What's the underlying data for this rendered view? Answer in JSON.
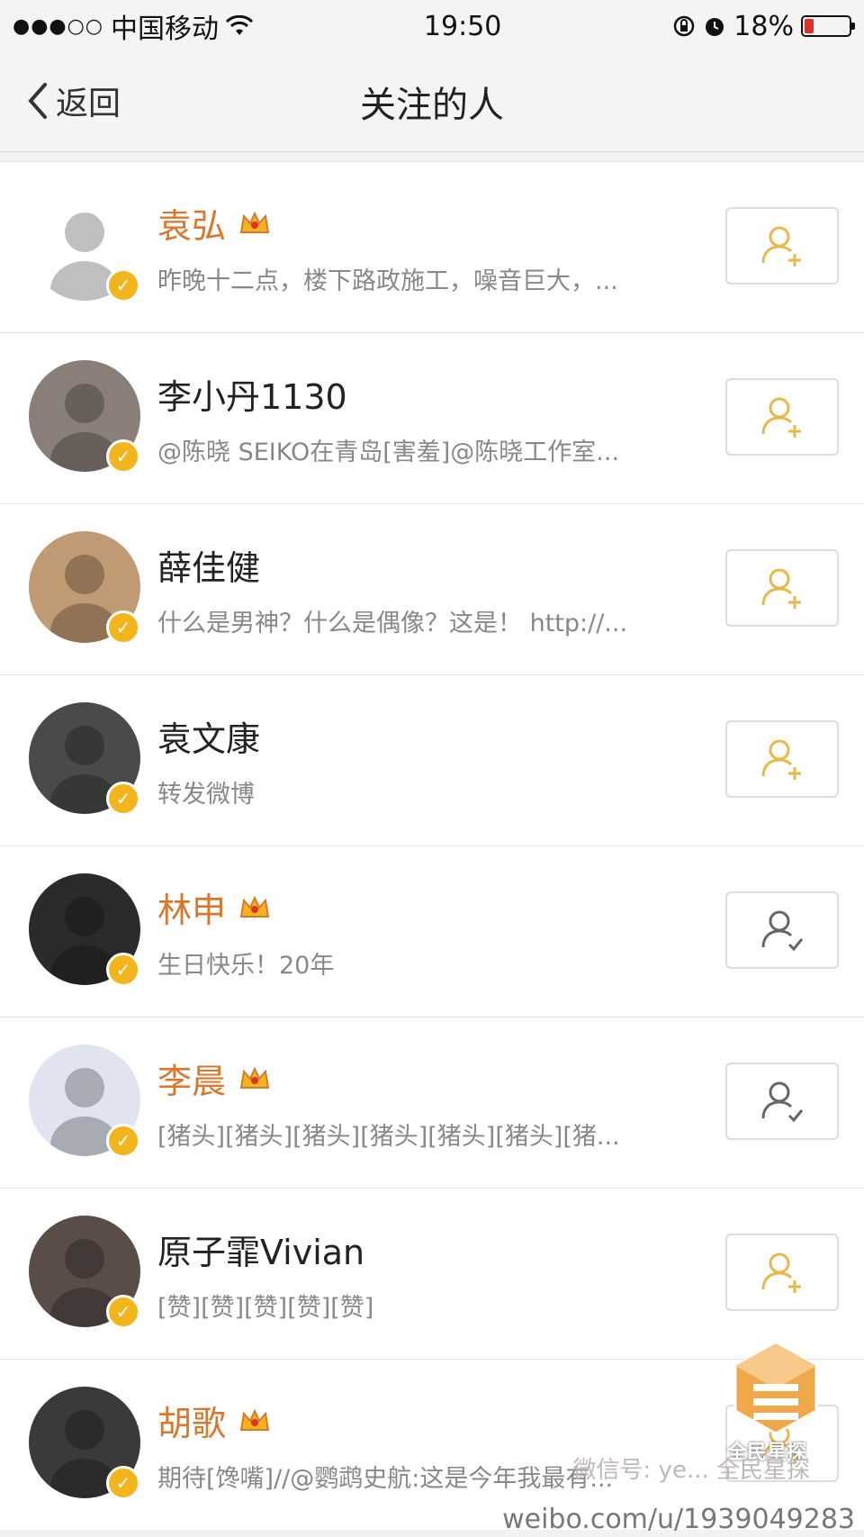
{
  "status_bar": {
    "signal": "●●●○○",
    "carrier": "中国移动",
    "time": "19:50",
    "battery": "18%",
    "battery_level": 0.18
  },
  "nav": {
    "back_label": "返回",
    "title": "关注的人"
  },
  "users": [
    {
      "name": "袁弘",
      "vip": true,
      "desc": "昨晚十二点，楼下路政施工，噪音巨大，...",
      "following": false,
      "avatar_color": "#ffffff"
    },
    {
      "name": "李小丹1130",
      "vip": false,
      "desc": "@陈晓 SEIKO在青岛[害羞]@陈晓工作室...",
      "following": false,
      "avatar_color": "#8a7f78"
    },
    {
      "name": "薛佳健",
      "vip": false,
      "desc": "什么是男神？什么是偶像？这是！ http://...",
      "following": false,
      "avatar_color": "#c09a72"
    },
    {
      "name": "袁文康",
      "vip": false,
      "desc": "转发微博",
      "following": false,
      "avatar_color": "#4a4a4a"
    },
    {
      "name": "林申",
      "vip": true,
      "desc": "生日快乐！20年",
      "following": true,
      "avatar_color": "#2b2b2b"
    },
    {
      "name": "李晨",
      "vip": true,
      "desc": "[猪头][猪头][猪头][猪头][猪头][猪头][猪...",
      "following": true,
      "avatar_color": "#dfe4f0"
    },
    {
      "name": "原子霏Vivian",
      "vip": false,
      "desc": "[赞][赞][赞][赞][赞]",
      "following": false,
      "avatar_color": "#5a4d48"
    },
    {
      "name": "胡歌",
      "vip": true,
      "desc": "期待[馋嘴]//@鹦鹉史航:这是今年我最有...",
      "following": false,
      "avatar_color": "#3a3a3a"
    }
  ],
  "watermark": {
    "brand": "全民星探",
    "wechat": "微信号: ye... 全民星探",
    "url": "weibo.com/u/1939049283"
  },
  "colors": {
    "accent": "#f2b51c",
    "vip_name": "#d9772c",
    "follow_icon": "#e8b84a"
  }
}
